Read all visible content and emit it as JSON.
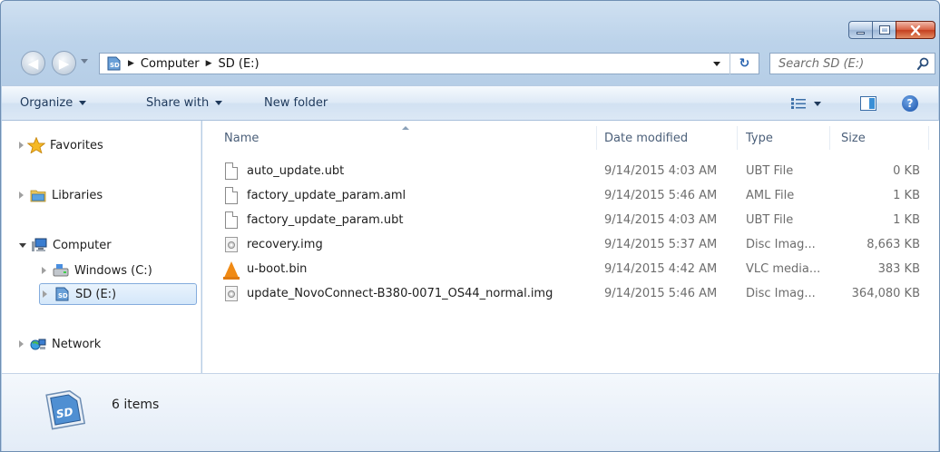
{
  "address": {
    "crumbs": [
      "Computer",
      "SD (E:)"
    ]
  },
  "search": {
    "placeholder": "Search SD (E:)"
  },
  "toolbar": {
    "organize": "Organize",
    "share_with": "Share with",
    "new_folder": "New folder"
  },
  "nav": {
    "favorites": "Favorites",
    "libraries": "Libraries",
    "computer": "Computer",
    "windows_c": "Windows (C:)",
    "sd_e": "SD (E:)",
    "network": "Network"
  },
  "columns": {
    "name": "Name",
    "date_modified": "Date modified",
    "type": "Type",
    "size": "Size"
  },
  "files": [
    {
      "name": "auto_update.ubt",
      "date": "9/14/2015 4:03 AM",
      "type": "UBT File",
      "size": "0 KB",
      "icon": "document-icon"
    },
    {
      "name": "factory_update_param.aml",
      "date": "9/14/2015 5:46 AM",
      "type": "AML File",
      "size": "1 KB",
      "icon": "document-icon"
    },
    {
      "name": "factory_update_param.ubt",
      "date": "9/14/2015 4:03 AM",
      "type": "UBT File",
      "size": "1 KB",
      "icon": "document-icon"
    },
    {
      "name": "recovery.img",
      "date": "9/14/2015 5:37 AM",
      "type": "Disc Imag...",
      "size": "8,663 KB",
      "icon": "disc-image-icon"
    },
    {
      "name": "u-boot.bin",
      "date": "9/14/2015 4:42 AM",
      "type": "VLC media...",
      "size": "383 KB",
      "icon": "vlc-cone-icon"
    },
    {
      "name": "update_NovoConnect-B380-0071_OS44_normal.img",
      "date": "9/14/2015 5:46 AM",
      "type": "Disc Imag...",
      "size": "364,080 KB",
      "icon": "disc-image-icon"
    }
  ],
  "details": {
    "items_count": "6 items"
  },
  "colors": {
    "frame": "#bcd3ea",
    "close_button": "#c4401f",
    "selection_border": "#84acdd",
    "header_text": "#4c607a"
  }
}
